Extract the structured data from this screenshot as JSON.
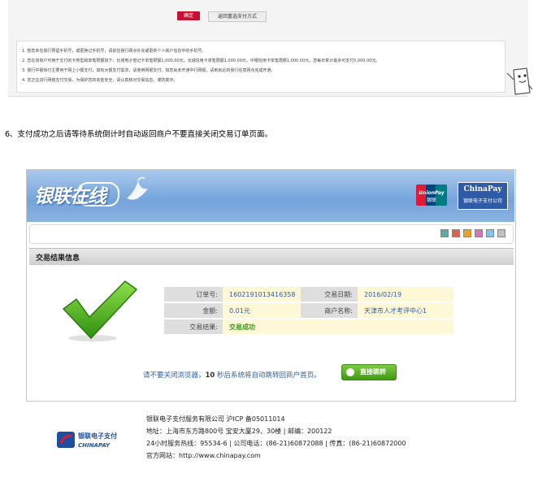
{
  "top_panel": {
    "confirm_label": "确定",
    "reselect_label": "返回重选支付方式",
    "notices": [
      "1. 若您未在我行预留手机号，或更换过手机号，请前往我行网点补充或更新个人账户信息中的手机号。",
      "2. 您在该商户可用于支付的卡类型和单笔限额如下：长城电子借记卡单笔限额1,000.00元，长城信用卡单笔限额1,000.00元，中银信用卡单笔限额1,000.00元，您每日累计最多可支付5,000.00元。",
      "3. 我行中银快付主要用于网上小额支付，如有大额支付需求，请使用网银支付。如您尚未开通中行网银，请到就近的我行任意网点完成开通。",
      "4. 您正在进行网络支付交易，为保护您的资金安全，请认真核对交易信息，谨防欺诈。"
    ]
  },
  "step_text": "6、支付成功之后请等待系统倒计时自动返回商户不要直接关闭交易订单页面。",
  "banner": {
    "logo_text": "银联在线",
    "unionpay_text": "UnionPay",
    "unionpay_cn": "银联",
    "chinapay_name": "ChinaPay",
    "chinapay_sub": "银联电子支付公司"
  },
  "swatch_colors": [
    "#5fa8a5",
    "#e0604a",
    "#f0a020",
    "#d86fb8",
    "#7fc4ea",
    "#c0c0c0",
    "#6aa0d8"
  ],
  "section_title": "交易结果信息",
  "info": {
    "order_label": "订单号:",
    "order_value": "1602191013416358",
    "date_label": "交易日期:",
    "date_value": "2016/02/19",
    "amount_label": "金额:",
    "amount_value": "0.01元",
    "merchant_label": "商户名称:",
    "merchant_value": "天津市人才考评中心1",
    "result_label": "交易结果:",
    "result_value": "交易成功"
  },
  "tip": {
    "before": "请不要关闭浏览器，",
    "count": "10",
    "after": " 秒后系统将自动跳转回商户首页。"
  },
  "jump_label": "直接跳转",
  "footer": {
    "logo_cn": "银联电子支付",
    "logo_en": "CHINAPAY",
    "company": "银联电子支付服务有限公司 沪ICP 备05011014",
    "address": "地址：上海市东方路800号 宝安大厦29、30楼 | 邮编：200122",
    "phones": "24小时服务热线：95534-6 | 公司电话：(86-21)60872088 | 传真：(86-21)60872000",
    "website": "官方网站：http://www.chinapay.com"
  }
}
